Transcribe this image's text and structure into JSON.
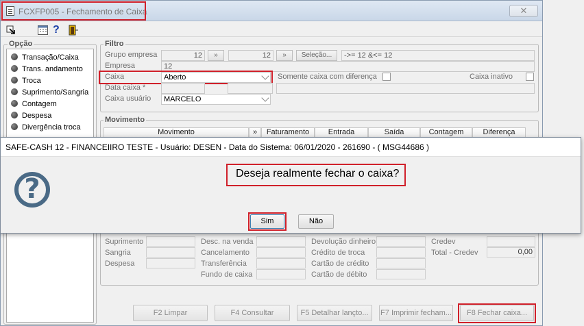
{
  "window": {
    "title": "FCXFP005 - Fechamento de Caixa",
    "close_glyph": "✕"
  },
  "opcao": {
    "title": "Opção",
    "items": [
      "Transação/Caixa",
      "Trans. andamento",
      "Troca",
      "Suprimento/Sangria",
      "Contagem",
      "Despesa",
      "Divergência troca"
    ]
  },
  "filtro": {
    "title": "Filtro",
    "grupo_label": "Grupo empresa",
    "grupo_from": "12",
    "grupo_to": "12",
    "selecao_label": "Seleção...",
    "range_text": "->= 12 &<= 12",
    "empresa_label": "Empresa",
    "empresa_value": "12",
    "caixa_label": "Caixa",
    "caixa_value": "Aberto",
    "somente_label": "Somente caixa com diferença",
    "inativo_label": "Caixa inativo",
    "data_label": "Data caixa *",
    "usuario_label": "Caixa usuário",
    "usuario_value": "MARCELO"
  },
  "movimento": {
    "title": "Movimento",
    "columns": [
      "Movimento",
      "Faturamento",
      "Entrada",
      "Saída",
      "Contagem",
      "Diferença"
    ]
  },
  "summary": {
    "col1": [
      "Suprimento",
      "Sangria",
      "Despesa"
    ],
    "col2": [
      "Desc. na venda",
      "Cancelamento",
      "Transferência",
      "Fundo de caixa"
    ],
    "col3": [
      "Devolução dinheiro",
      "Crédito de troca",
      "Cartão de crédito",
      "Cartão de débito"
    ],
    "col4": [
      "Credev",
      "Total - Credev"
    ],
    "total_value": "0,00"
  },
  "footer": {
    "limpar": "F2 Limpar",
    "consultar": "F4 Consultar",
    "detalhar": "F5 Detalhar lançto...",
    "imprimir": "F7 Imprimir fecham...",
    "fechar": "F8 Fechar caixa..."
  },
  "dialog": {
    "title": "SAFE-CASH 12 - FINANCEIIRO TESTE - Usuário: DESEN - Data do Sistema: 06/01/2020 - 261690 - ( MSG44686 )",
    "message": "Deseja realmente fechar o caixa?",
    "yes": "Sim",
    "no": "Não",
    "icon_glyph": "?"
  },
  "colors": {
    "highlight": "#d0202a",
    "icon_blue": "#4a6a86"
  }
}
